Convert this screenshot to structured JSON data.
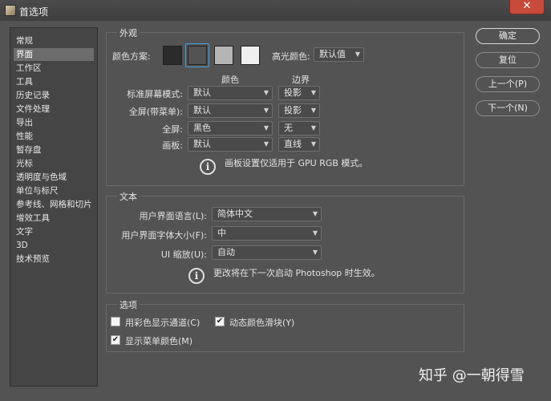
{
  "window": {
    "title": "首选项",
    "close_glyph": "✕"
  },
  "nav": {
    "items": [
      "常规",
      "界面",
      "工作区",
      "工具",
      "历史记录",
      "文件处理",
      "导出",
      "性能",
      "暂存盘",
      "光标",
      "透明度与色域",
      "单位与标尺",
      "参考线、网格和切片",
      "增效工具",
      "文字",
      "3D",
      "技术预览"
    ],
    "selected": "界面"
  },
  "appearance": {
    "group_label": "外观",
    "color_scheme_label": "颜色方案:",
    "swatches": [
      "#2b2b2b",
      "#535353",
      "#b5b5b5",
      "#efefef"
    ],
    "selected_swatch": 1,
    "highlight_label": "高光颜色:",
    "highlight_value": "默认值",
    "col_color": "颜色",
    "col_border": "边界",
    "rows": [
      {
        "label": "标准屏幕模式:",
        "color": "默认",
        "border": "投影"
      },
      {
        "label": "全屏(带菜单):",
        "color": "默认",
        "border": "投影"
      },
      {
        "label": "全屏:",
        "color": "黑色",
        "border": "无"
      },
      {
        "label": "画板:",
        "color": "默认",
        "border": "直线"
      }
    ],
    "info_text": "画板设置仅适用于 GPU RGB 模式。"
  },
  "text": {
    "group_label": "文本",
    "ui_language_label": "用户界面语言(L):",
    "ui_language_value": "简体中文",
    "font_size_label": "用户界面字体大小(F):",
    "font_size_value": "中",
    "ui_scale_label": "UI 缩放(U):",
    "ui_scale_value": "自动",
    "info_text": "更改将在下一次启动 Photoshop 时生效。"
  },
  "options": {
    "group_label": "选项",
    "checkboxes": [
      {
        "label": "用彩色显示通道(C)",
        "checked": false
      },
      {
        "label": "动态颜色滑块(Y)",
        "checked": true
      },
      {
        "label": "显示菜单颜色(M)",
        "checked": true
      }
    ]
  },
  "buttons": {
    "ok": "确定",
    "reset": "复位",
    "prev": "上一个(P)",
    "next": "下一个(N)"
  },
  "watermark": "知乎 @一朝得雪",
  "icons": {
    "info": "info-icon",
    "chevron": "chevron-down-icon",
    "check": "checkmark-icon"
  }
}
